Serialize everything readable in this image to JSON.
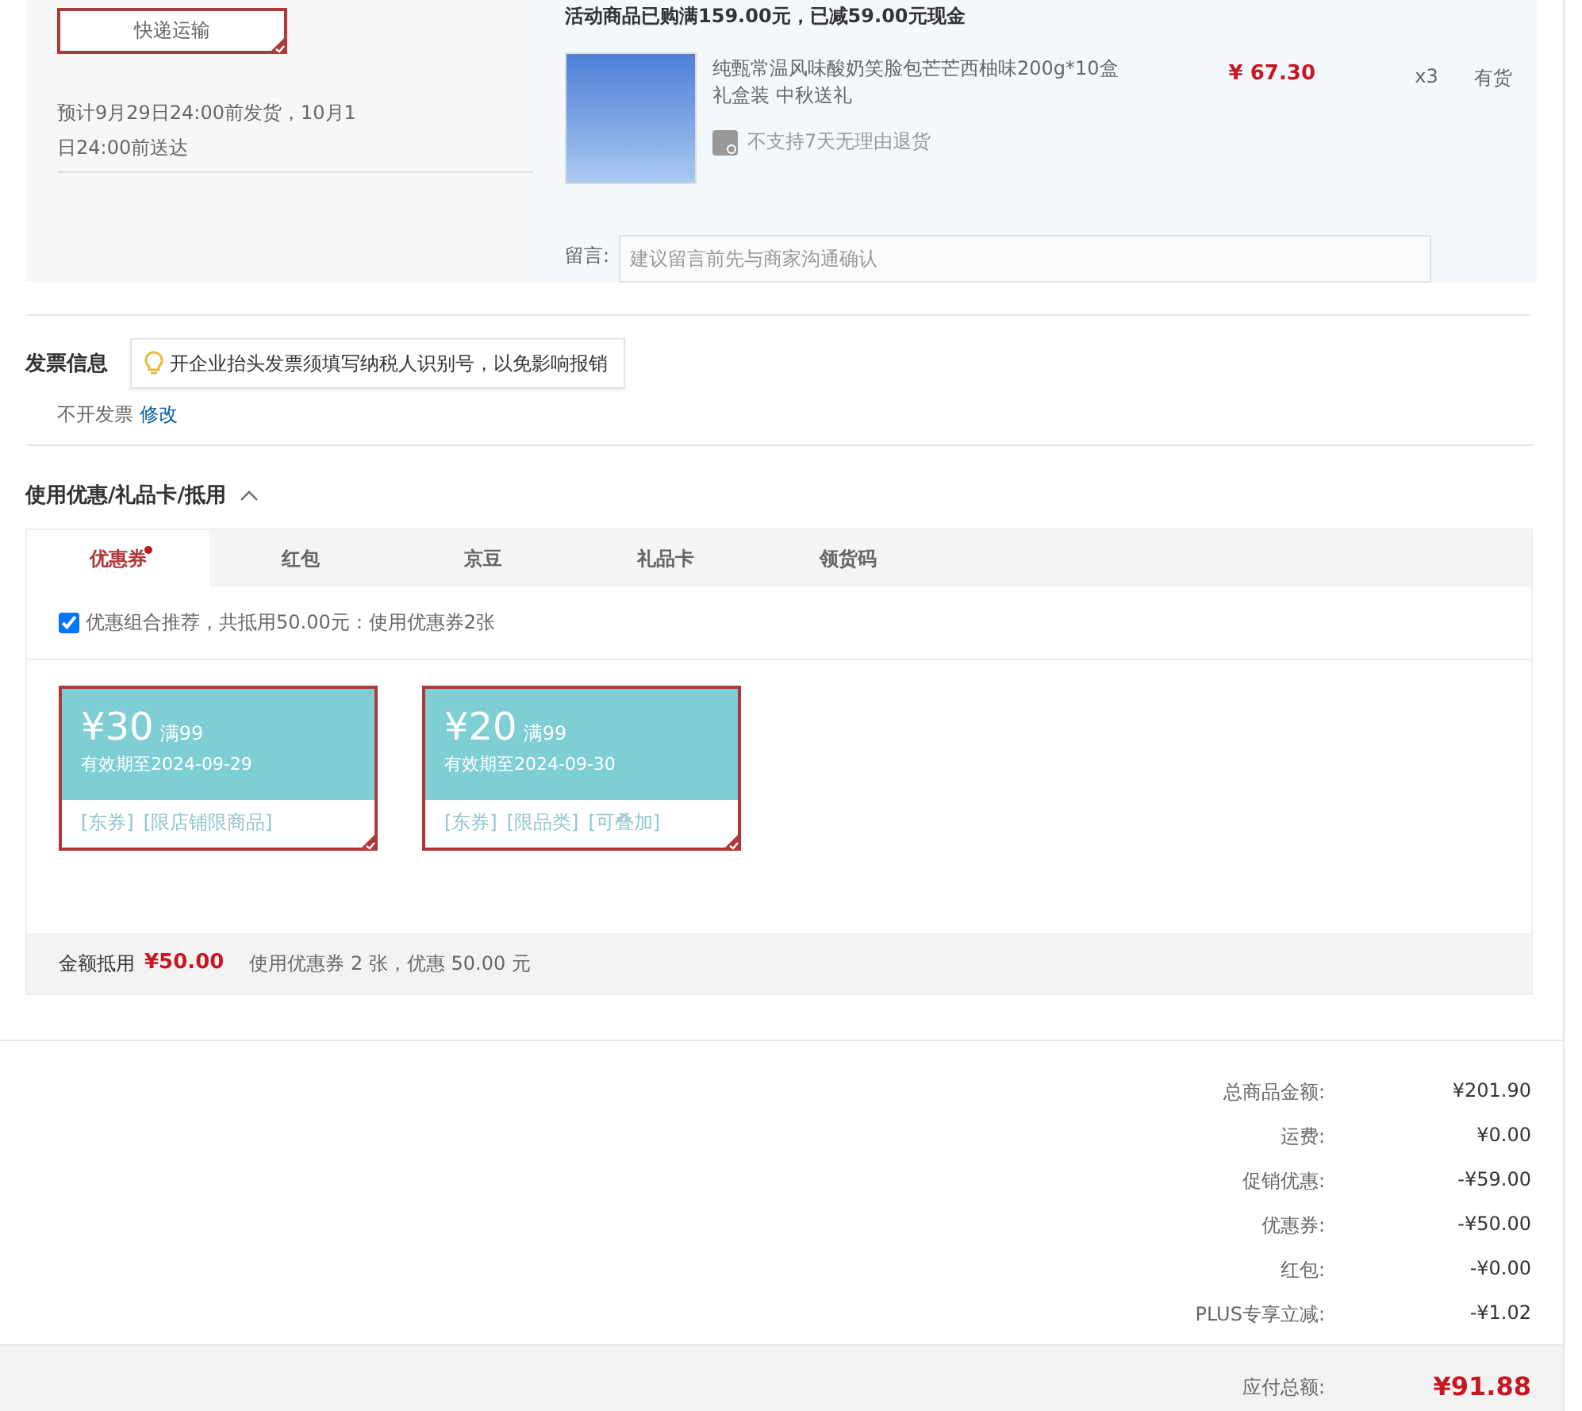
{
  "shipping": {
    "method": {
      "label": "快递运输",
      "selected": true
    },
    "estimate": "预计9月29日24:00前发货，10月1日24:00前送达"
  },
  "order_group": {
    "promo_note": "活动商品已购满159.00元，已减59.00元现金",
    "item": {
      "title": "纯甄常温风味酸奶笑脸包芒芒西柚味200g*10盒礼盒装 中秋送礼",
      "price": "¥ 67.30",
      "quantity": "x3",
      "stock": "有货",
      "return_policy": "不支持7天无理由退货"
    },
    "message": {
      "label": "留言:",
      "placeholder": "建议留言前先与商家沟通确认"
    }
  },
  "invoice": {
    "title": "发票信息",
    "tip": "开企业抬头发票须填写纳税人识别号，以免影响报销",
    "value": "不开发票",
    "edit_link": "修改"
  },
  "discounts": {
    "title": "使用优惠/礼品卡/抵用",
    "expanded": true,
    "tabs": [
      {
        "label": "优惠券",
        "selected": true,
        "dot": true
      },
      {
        "label": "红包",
        "selected": false,
        "dot": false
      },
      {
        "label": "京豆",
        "selected": false,
        "dot": false
      },
      {
        "label": "礼品卡",
        "selected": false,
        "dot": false
      },
      {
        "label": "领货码",
        "selected": false,
        "dot": false
      }
    ],
    "recommend": {
      "checked": true,
      "label": "优惠组合推荐，共抵用50.00元：使用优惠券2张"
    },
    "coupons": [
      {
        "amount": "¥30",
        "condition": "满99",
        "validity": "有效期至2024-09-29",
        "tags": [
          "[东券]",
          "[限店铺限商品]"
        ],
        "selected": true
      },
      {
        "amount": "¥20",
        "condition": "满99",
        "validity": "有效期至2024-09-30",
        "tags": [
          "[东券]",
          "[限品类]",
          "[可叠加]"
        ],
        "selected": true
      }
    ],
    "summary": {
      "label": "金额抵用",
      "amount": "¥50.00",
      "detail": "使用优惠券 2 张，优惠 50.00 元"
    }
  },
  "totals": {
    "rows": [
      {
        "label": "总商品金额:",
        "value": "¥201.90"
      },
      {
        "label": "运费:",
        "value": "¥0.00"
      },
      {
        "label": "促销优惠:",
        "value": "-¥59.00"
      },
      {
        "label": "优惠券:",
        "value": "-¥50.00"
      },
      {
        "label": "红包:",
        "value": "-¥0.00"
      },
      {
        "label": "PLUS专享立减:",
        "value": "-¥1.02"
      }
    ],
    "payable_label": "应付总额:",
    "payable_value": "¥91.88"
  }
}
